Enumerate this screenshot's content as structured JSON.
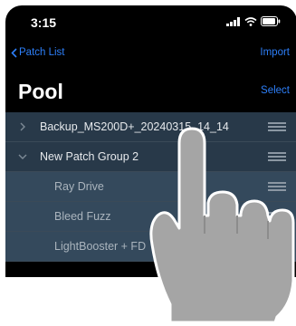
{
  "status": {
    "time": "3:15"
  },
  "nav": {
    "back_label": "Patch List",
    "import_label": "Import"
  },
  "header": {
    "title": "Pool",
    "select_label": "Select"
  },
  "list": {
    "rows": [
      {
        "label": "Backup_MS200D+_20240315_14_14",
        "type": "group",
        "expanded": false
      },
      {
        "label": "New Patch Group 2",
        "type": "group",
        "expanded": true
      },
      {
        "label": "Ray Drive",
        "type": "patch"
      },
      {
        "label": "Bleed Fuzz",
        "type": "patch"
      },
      {
        "label": "LightBooster + FD",
        "type": "patch"
      }
    ]
  },
  "colors": {
    "accent": "#2d7ff9",
    "group_row": "#283949",
    "patch_row": "#34495c",
    "hand": "#a5a5a5"
  },
  "icons": [
    "signal-icon",
    "wifi-icon",
    "battery-icon",
    "chevron-left-icon",
    "chevron-right-icon",
    "chevron-down-icon",
    "drag-handle-icon",
    "pointing-hand-icon"
  ]
}
